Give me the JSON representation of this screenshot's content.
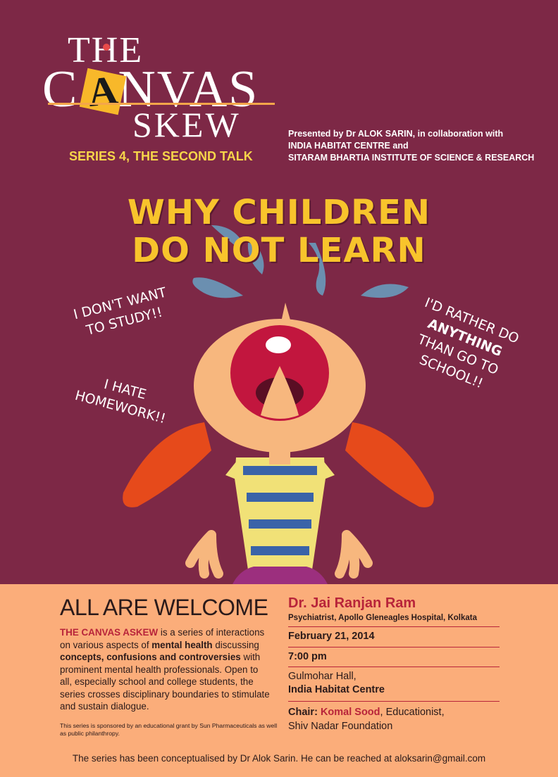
{
  "logo": {
    "line1": "THE",
    "line2_pre": "C",
    "line2_a": "A",
    "line2_post": "NVAS",
    "line3": "SKEW"
  },
  "series": "SERIES 4, THE SECOND TALK",
  "presented": {
    "line1": "Presented by Dr ALOK SARIN, in collaboration with",
    "line2": "INDIA HABITAT CENTRE and",
    "line3": "SITARAM BHARTIA INSTITUTE OF SCIENCE & RESEARCH"
  },
  "headline": {
    "line1": "WHY CHILDREN",
    "line2": "DO NOT LEARN"
  },
  "bubbles": {
    "b1_line1": "I DON'T WANT",
    "b1_line2": "TO STUDY!!",
    "b2_line1": "I HATE",
    "b2_line2": "HOMEWORK!!",
    "b3_line1": "I'D RATHER DO",
    "b3_line2": "ANYTHING",
    "b3_line3": "THAN GO TO",
    "b3_line4": "SCHOOL!!"
  },
  "welcome": "ALL ARE WELCOME",
  "description": {
    "name": "THE CANVAS ASKEW",
    "t1": " is a series of interactions on various aspects of ",
    "b1": "mental health",
    "t2": " discussing ",
    "b2": "concepts, confusions and controversies",
    "t3": " with prominent mental health professionals. Open to all, especially school and college students, the series crosses disciplinary boundaries to stimulate and sustain dialogue."
  },
  "sponsor": "This series is sponsored by an educational grant by Sun Pharmaceuticals as well as public philanthropy.",
  "event": {
    "speaker": "Dr. Jai Ranjan Ram",
    "role": "Psychiatrist, Apollo Gleneagles Hospital, Kolkata",
    "date": "February 21, 2014",
    "time": "7:00 pm",
    "venue_line1": "Gulmohar Hall,",
    "venue_line2": "India Habitat Centre",
    "chair_label": "Chair:",
    "chair_name": "Komal Sood",
    "chair_rest1": ", Educationist,",
    "chair_rest2": "Shiv Nadar Foundation"
  },
  "footer": "The series has been conceptualised by Dr Alok Sarin. He can be reached at aloksarin@gmail.com",
  "colors": {
    "maroon": "#7d2846",
    "peach": "#fbad7a",
    "yellow": "#f8c42c",
    "red_text": "#b8243a"
  }
}
